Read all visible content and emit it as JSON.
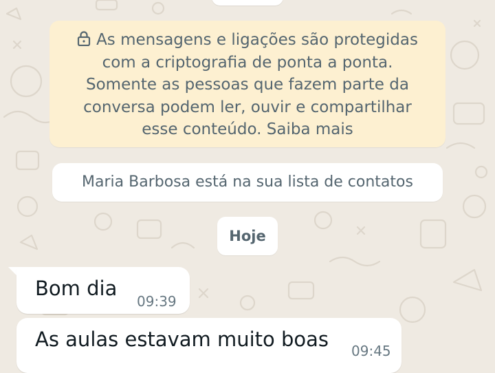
{
  "encryption_notice": {
    "lines": [
      "As mensagens e ligações são protegidas",
      "com a criptografia de ponta a ponta.",
      "Somente as pessoas que fazem parte da",
      "conversa podem ler, ouvir e compartilhar",
      "esse conteúdo. Saiba mais"
    ],
    "icon": "lock-icon"
  },
  "contact_notice": "Maria Barbosa está na sua lista de contatos",
  "date_label": "Hoje",
  "messages": [
    {
      "text": "Bom dia",
      "time": "09:39"
    },
    {
      "text": "As aulas estavam muito boas",
      "time": "09:45"
    }
  ],
  "colors": {
    "background": "#efeae2",
    "encryption_bg": "#fdf0d1",
    "bubble_bg": "#ffffff",
    "system_text": "#54656f",
    "message_text": "#111b21",
    "time_text": "#667781"
  }
}
